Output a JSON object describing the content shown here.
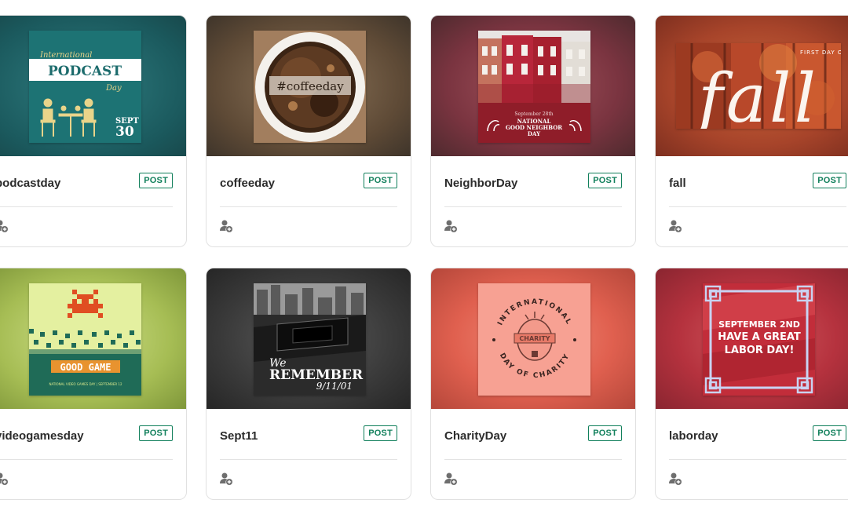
{
  "cards": [
    {
      "title": "podcastday",
      "badge": "POST",
      "icon": "assign-user-icon",
      "art": "podcast",
      "bg": "#1e6a6f"
    },
    {
      "title": "coffeeday",
      "badge": "POST",
      "icon": "assign-user-icon",
      "art": "coffee",
      "bg": "#5c4a36"
    },
    {
      "title": "NeighborDay",
      "badge": "POST",
      "icon": "assign-user-icon",
      "art": "neighbor",
      "bg": "#7a3440"
    },
    {
      "title": "fall",
      "badge": "POST",
      "icon": "assign-user-icon",
      "art": "fall",
      "bg": "#a7442a"
    },
    {
      "title": "videogamesday",
      "badge": "POST",
      "icon": "assign-user-icon",
      "art": "videogame",
      "bg": "#a6bd54"
    },
    {
      "title": "Sept11",
      "badge": "POST",
      "icon": "assign-user-icon",
      "art": "sept11",
      "bg": "#3a3a3a"
    },
    {
      "title": "CharityDay",
      "badge": "POST",
      "icon": "assign-user-icon",
      "art": "charity",
      "bg": "#e0604f"
    },
    {
      "title": "laborday",
      "badge": "POST",
      "icon": "assign-user-icon",
      "art": "labor",
      "bg": "#b5323e"
    }
  ],
  "artwork_text": {
    "podcast": {
      "line1": "International",
      "line2": "PODCAST",
      "line3": "Day",
      "date1": "SEPT",
      "date2": "30"
    },
    "coffee": {
      "tag": "#coffeeday"
    },
    "neighbor": {
      "line1": "September 28th",
      "line2": "NATIONAL",
      "line3": "GOOD NEIGHBOR",
      "line4": "DAY"
    },
    "fall": {
      "small": "FIRST DAY OF",
      "big": "fall"
    },
    "videogame": {
      "label": "GOOD GAME",
      "sub": "NATIONAL VIDEO GAMES DAY | SEPTEMBER 12"
    },
    "sept11": {
      "line1": "We",
      "line2": "REMEMBER",
      "line3": "9/11/01"
    },
    "charity": {
      "top": "INTERNATIONAL",
      "bottom": "DAY OF CHARITY",
      "center": "CHARITY"
    },
    "labor": {
      "line1": "SEPTEMBER 2ND",
      "line2": "HAVE A GREAT",
      "line3": "LABOR DAY!"
    }
  }
}
